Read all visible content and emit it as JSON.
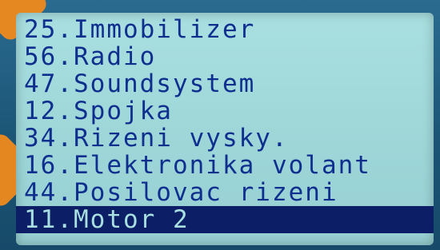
{
  "menu": {
    "items": [
      {
        "label": "25.Immobilizer",
        "selected": false
      },
      {
        "label": "56.Radio",
        "selected": false
      },
      {
        "label": "47.Soundsystem",
        "selected": false
      },
      {
        "label": "12.Spojka",
        "selected": false
      },
      {
        "label": "34.Rizeni vysky.",
        "selected": false
      },
      {
        "label": "16.Elektronika volant",
        "selected": false
      },
      {
        "label": "44.Posilovac rizeni",
        "selected": false
      },
      {
        "label": "11.Motor 2",
        "selected": true
      }
    ]
  },
  "colors": {
    "lcd_background": "#a9dfe0",
    "text": "#0f2f8e",
    "selection_background": "#0c1f66",
    "bezel": "#1f5a7c",
    "accent": "#f08a1c"
  }
}
